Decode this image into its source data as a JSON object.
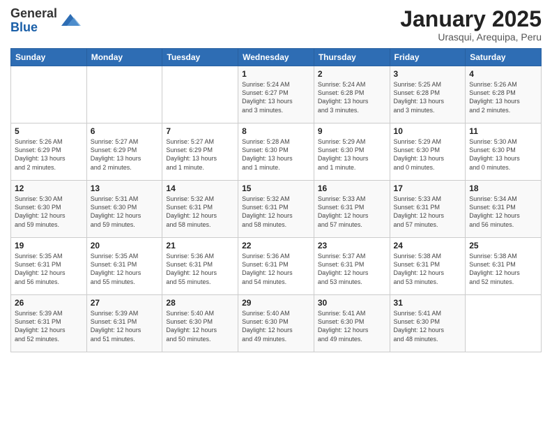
{
  "logo": {
    "general": "General",
    "blue": "Blue"
  },
  "title": "January 2025",
  "subtitle": "Urasqui, Arequipa, Peru",
  "days_of_week": [
    "Sunday",
    "Monday",
    "Tuesday",
    "Wednesday",
    "Thursday",
    "Friday",
    "Saturday"
  ],
  "weeks": [
    [
      {
        "day": "",
        "info": ""
      },
      {
        "day": "",
        "info": ""
      },
      {
        "day": "",
        "info": ""
      },
      {
        "day": "1",
        "info": "Sunrise: 5:24 AM\nSunset: 6:27 PM\nDaylight: 13 hours\nand 3 minutes."
      },
      {
        "day": "2",
        "info": "Sunrise: 5:24 AM\nSunset: 6:28 PM\nDaylight: 13 hours\nand 3 minutes."
      },
      {
        "day": "3",
        "info": "Sunrise: 5:25 AM\nSunset: 6:28 PM\nDaylight: 13 hours\nand 3 minutes."
      },
      {
        "day": "4",
        "info": "Sunrise: 5:26 AM\nSunset: 6:28 PM\nDaylight: 13 hours\nand 2 minutes."
      }
    ],
    [
      {
        "day": "5",
        "info": "Sunrise: 5:26 AM\nSunset: 6:29 PM\nDaylight: 13 hours\nand 2 minutes."
      },
      {
        "day": "6",
        "info": "Sunrise: 5:27 AM\nSunset: 6:29 PM\nDaylight: 13 hours\nand 2 minutes."
      },
      {
        "day": "7",
        "info": "Sunrise: 5:27 AM\nSunset: 6:29 PM\nDaylight: 13 hours\nand 1 minute."
      },
      {
        "day": "8",
        "info": "Sunrise: 5:28 AM\nSunset: 6:30 PM\nDaylight: 13 hours\nand 1 minute."
      },
      {
        "day": "9",
        "info": "Sunrise: 5:29 AM\nSunset: 6:30 PM\nDaylight: 13 hours\nand 1 minute."
      },
      {
        "day": "10",
        "info": "Sunrise: 5:29 AM\nSunset: 6:30 PM\nDaylight: 13 hours\nand 0 minutes."
      },
      {
        "day": "11",
        "info": "Sunrise: 5:30 AM\nSunset: 6:30 PM\nDaylight: 13 hours\nand 0 minutes."
      }
    ],
    [
      {
        "day": "12",
        "info": "Sunrise: 5:30 AM\nSunset: 6:30 PM\nDaylight: 12 hours\nand 59 minutes."
      },
      {
        "day": "13",
        "info": "Sunrise: 5:31 AM\nSunset: 6:30 PM\nDaylight: 12 hours\nand 59 minutes."
      },
      {
        "day": "14",
        "info": "Sunrise: 5:32 AM\nSunset: 6:31 PM\nDaylight: 12 hours\nand 58 minutes."
      },
      {
        "day": "15",
        "info": "Sunrise: 5:32 AM\nSunset: 6:31 PM\nDaylight: 12 hours\nand 58 minutes."
      },
      {
        "day": "16",
        "info": "Sunrise: 5:33 AM\nSunset: 6:31 PM\nDaylight: 12 hours\nand 57 minutes."
      },
      {
        "day": "17",
        "info": "Sunrise: 5:33 AM\nSunset: 6:31 PM\nDaylight: 12 hours\nand 57 minutes."
      },
      {
        "day": "18",
        "info": "Sunrise: 5:34 AM\nSunset: 6:31 PM\nDaylight: 12 hours\nand 56 minutes."
      }
    ],
    [
      {
        "day": "19",
        "info": "Sunrise: 5:35 AM\nSunset: 6:31 PM\nDaylight: 12 hours\nand 56 minutes."
      },
      {
        "day": "20",
        "info": "Sunrise: 5:35 AM\nSunset: 6:31 PM\nDaylight: 12 hours\nand 55 minutes."
      },
      {
        "day": "21",
        "info": "Sunrise: 5:36 AM\nSunset: 6:31 PM\nDaylight: 12 hours\nand 55 minutes."
      },
      {
        "day": "22",
        "info": "Sunrise: 5:36 AM\nSunset: 6:31 PM\nDaylight: 12 hours\nand 54 minutes."
      },
      {
        "day": "23",
        "info": "Sunrise: 5:37 AM\nSunset: 6:31 PM\nDaylight: 12 hours\nand 53 minutes."
      },
      {
        "day": "24",
        "info": "Sunrise: 5:38 AM\nSunset: 6:31 PM\nDaylight: 12 hours\nand 53 minutes."
      },
      {
        "day": "25",
        "info": "Sunrise: 5:38 AM\nSunset: 6:31 PM\nDaylight: 12 hours\nand 52 minutes."
      }
    ],
    [
      {
        "day": "26",
        "info": "Sunrise: 5:39 AM\nSunset: 6:31 PM\nDaylight: 12 hours\nand 52 minutes."
      },
      {
        "day": "27",
        "info": "Sunrise: 5:39 AM\nSunset: 6:31 PM\nDaylight: 12 hours\nand 51 minutes."
      },
      {
        "day": "28",
        "info": "Sunrise: 5:40 AM\nSunset: 6:30 PM\nDaylight: 12 hours\nand 50 minutes."
      },
      {
        "day": "29",
        "info": "Sunrise: 5:40 AM\nSunset: 6:30 PM\nDaylight: 12 hours\nand 49 minutes."
      },
      {
        "day": "30",
        "info": "Sunrise: 5:41 AM\nSunset: 6:30 PM\nDaylight: 12 hours\nand 49 minutes."
      },
      {
        "day": "31",
        "info": "Sunrise: 5:41 AM\nSunset: 6:30 PM\nDaylight: 12 hours\nand 48 minutes."
      },
      {
        "day": "",
        "info": ""
      }
    ]
  ]
}
